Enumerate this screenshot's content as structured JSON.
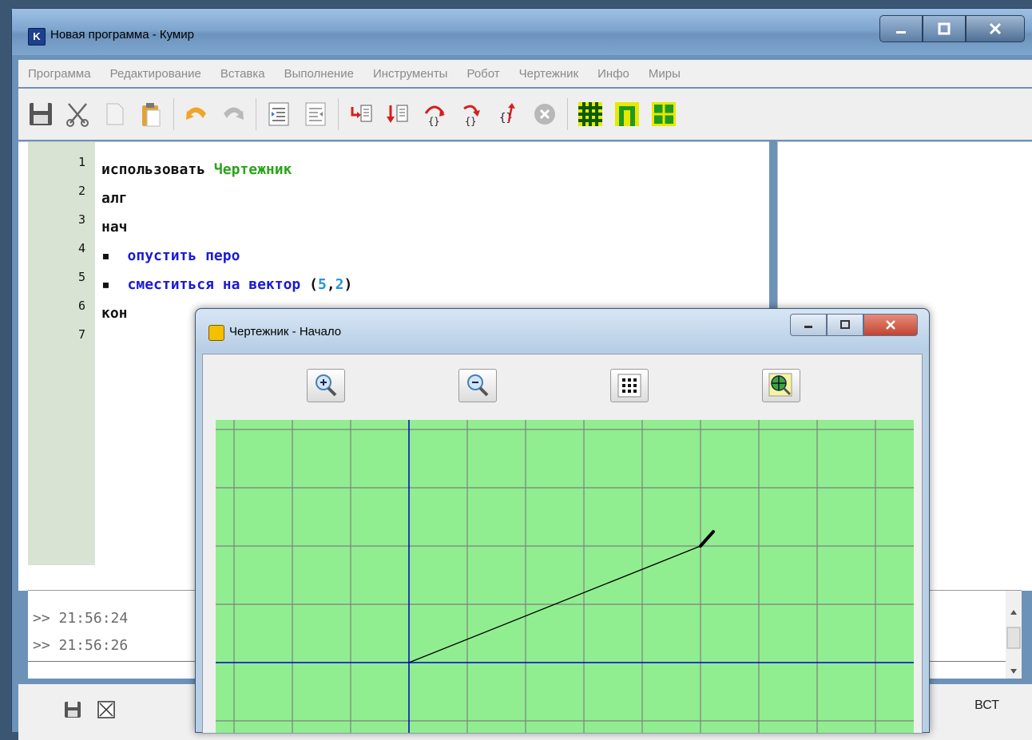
{
  "app": {
    "title": "Новая программа - Кумир",
    "icon_letter": "K"
  },
  "menu": [
    "Программа",
    "Редактирование",
    "Вставка",
    "Выполнение",
    "Инструменты",
    "Робот",
    "Чертежник",
    "Инфо",
    "Миры"
  ],
  "toolbar_icons": [
    "save-icon",
    "cut-icon",
    "copy-icon",
    "paste-icon",
    "undo-icon",
    "redo-icon",
    "indent-icon",
    "unindent-icon",
    "run-icon",
    "run-step-icon",
    "step-in-icon",
    "step-over-icon",
    "step-out-icon",
    "stop-icon",
    "robot-field-icon",
    "drawer-icon",
    "drawer-axes-icon"
  ],
  "editor": {
    "line_numbers": [
      "1",
      "2",
      "3",
      "4",
      "5",
      "6",
      "7"
    ],
    "lines": {
      "l1_kw": "использовать",
      "l1_mod": "Чертежник",
      "l2": "алг",
      "l3": "нач",
      "l4_bullet": "▪",
      "l4_cmd": "опустить перо",
      "l5_bullet": "▪",
      "l5_cmd": "сместиться на вектор",
      "l5_open": "(",
      "l5_a": "5",
      "l5_comma": ",",
      "l5_b": "2",
      "l5_close": ")",
      "l6": "кон"
    }
  },
  "console": {
    "lines": [
      ">> 21:56:24",
      ">> 21:56:26"
    ]
  },
  "status": {
    "mode": "ВСТ"
  },
  "drawer": {
    "title": "Чертежник - Начало",
    "buttons": [
      "zoom-in-icon",
      "zoom-out-icon",
      "grid-icon",
      "fit-icon"
    ],
    "grid_background": "#90ee90",
    "grid_line_color": "#808080",
    "axis_color": "#0000cc",
    "pen_start": [
      0,
      0
    ],
    "pen_vector": [
      5,
      2
    ]
  }
}
